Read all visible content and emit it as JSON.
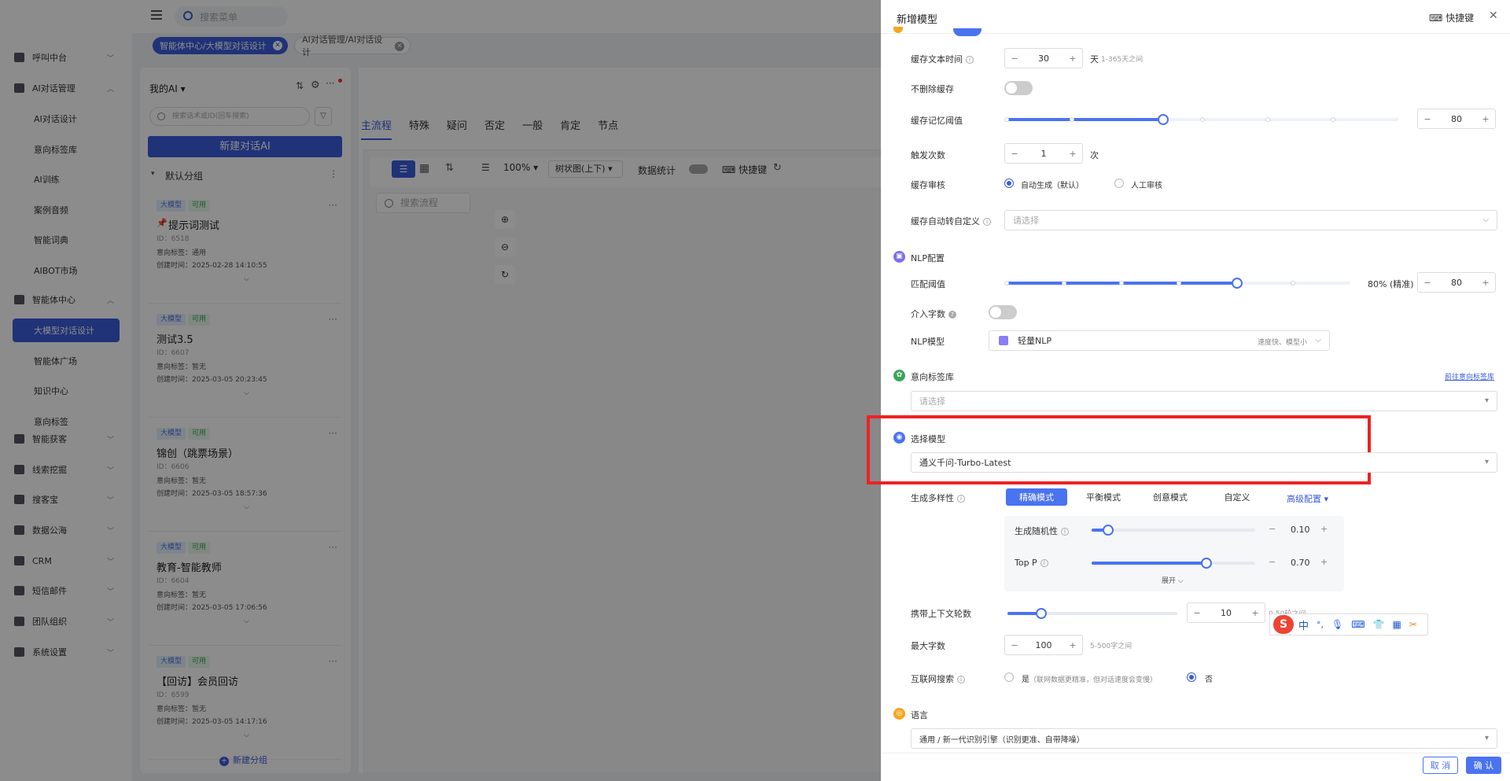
{
  "topbar": {
    "search_placeholder": "搜索菜单"
  },
  "tags": [
    "智能体中心/大模型对话设计",
    "AI对话管理/AI对话设计"
  ],
  "sidebar": {
    "groups": [
      {
        "label": "呼叫中台",
        "icon": "monitor-icon"
      },
      {
        "label": "AI对话管理",
        "icon": "dialog-icon"
      },
      {
        "label": "智能体中心",
        "icon": "agent-icon"
      },
      {
        "label": "智能获客",
        "icon": "search-icon"
      },
      {
        "label": "线索挖掘",
        "icon": "mine-icon"
      },
      {
        "label": "搜客宝",
        "icon": "search-icon"
      },
      {
        "label": "数据公海",
        "icon": "data-icon"
      },
      {
        "label": "CRM",
        "icon": "crm-icon"
      },
      {
        "label": "短信邮件",
        "icon": "sms-icon"
      },
      {
        "label": "团队组织",
        "icon": "team-icon"
      },
      {
        "label": "系统设置",
        "icon": "settings-icon"
      }
    ],
    "ai_sub": [
      "AI对话设计",
      "意向标签库",
      "AI训练",
      "案例音频",
      "智能词典",
      "AIBOT市场"
    ],
    "agent_sub": [
      "大模型对话设计",
      "智能体广场",
      "知识中心",
      "意向标签"
    ]
  },
  "left_panel": {
    "title": "我的AI",
    "search_placeholder": "搜索话术或ID(回车搜索)",
    "new_button": "新建对话AI",
    "group_name": "默认分组",
    "new_group": "新建分组",
    "cards": [
      {
        "b1": "大模型",
        "b2": "可用",
        "title": "提示词测试",
        "id": "ID：6518",
        "intent": "意向标签：通用",
        "created": "创建时间：2025-02-28 14:10:55"
      },
      {
        "b1": "大模型",
        "b2": "可用",
        "title": "测试3.5",
        "id": "ID：6607",
        "intent": "意向标签：暂无",
        "created": "创建时间：2025-03-05 20:23:45"
      },
      {
        "b1": "大模型",
        "b2": "可用",
        "title": "锦创（跳票场景）",
        "id": "ID：6606",
        "intent": "意向标签：暂无",
        "created": "创建时间：2025-03-05 18:57:36"
      },
      {
        "b1": "大模型",
        "b2": "可用",
        "title": "教育-智能教师",
        "id": "ID：6604",
        "intent": "意向标签：暂无",
        "created": "创建时间：2025-03-05 17:06:56"
      },
      {
        "b1": "大模型",
        "b2": "可用",
        "title": "【回访】会员回访",
        "id": "ID：6599",
        "intent": "意向标签：暂无",
        "created": "创建时间：2025-03-05 14:17:16"
      }
    ]
  },
  "canvas": {
    "tabs": [
      "主流程",
      "特殊",
      "疑问",
      "否定",
      "一般",
      "肯定",
      "节点"
    ],
    "zoom": "100%",
    "layout": "树状图(上下)",
    "stats": "数据统计",
    "shortcut": "快捷键",
    "search_flow": "搜索流程"
  },
  "drawer": {
    "title": "新增模型",
    "shortcut": "快捷键",
    "cache_time": {
      "label": "缓存文本时间",
      "value": "30",
      "unit": "天",
      "hint": "1-365天之间"
    },
    "no_delete": {
      "label": "不删除缓存"
    },
    "memory": {
      "label": "缓存记忆阈值",
      "value": "80",
      "level": 0.4
    },
    "trigger": {
      "label": "触发次数",
      "value": "1",
      "unit": "次"
    },
    "audit": {
      "label": "缓存审核",
      "opt1": "自动生成（默认）",
      "opt2": "人工审核"
    },
    "custom": {
      "label": "缓存自动转自定义",
      "placeholder": "请选择"
    },
    "nlp": {
      "title": "NLP配置",
      "match_label": "匹配阈值",
      "match_text": "80% (精准)",
      "match_value": "80",
      "match_level": 0.67,
      "intervene_label": "介入字数",
      "model_label": "NLP模型",
      "model_value": "轻量NLP",
      "model_hint": "速度快、模型小"
    },
    "intent": {
      "title": "意向标签库",
      "link": "前往意向标签库",
      "placeholder": "请选择"
    },
    "model": {
      "title": "选择模型",
      "value": "通义千问-Turbo-Latest"
    },
    "diversity": {
      "label": "生成多样性",
      "modes": [
        "精确模式",
        "平衡模式",
        "创意模式",
        "自定义"
      ],
      "advanced": "高级配置",
      "random_label": "生成随机性",
      "random_value": "0.10",
      "random_level": 0.1,
      "topp_label": "Top P",
      "topp_value": "0.70",
      "topp_level": 0.7,
      "expand": "展开"
    },
    "context": {
      "label": "携带上下文轮数",
      "value": "10",
      "hint": "0-50轮之间",
      "level": 0.2
    },
    "max_chars": {
      "label": "最大字数",
      "value": "100",
      "hint": "5-500字之间"
    },
    "web": {
      "label": "互联网搜索",
      "opt1": "是",
      "opt1_hint": "（联网数据更精准，但对话速度会变慢）",
      "opt2": "否"
    },
    "language": {
      "title": "语言",
      "value": "通用 / 新一代识别引擎（识别更准、自带降噪）"
    },
    "cancel": "取 消",
    "confirm": "确 认"
  },
  "ime": {
    "items": [
      "中",
      "°,",
      "mic",
      "keyboard",
      "skin",
      "apps",
      "tools"
    ]
  }
}
